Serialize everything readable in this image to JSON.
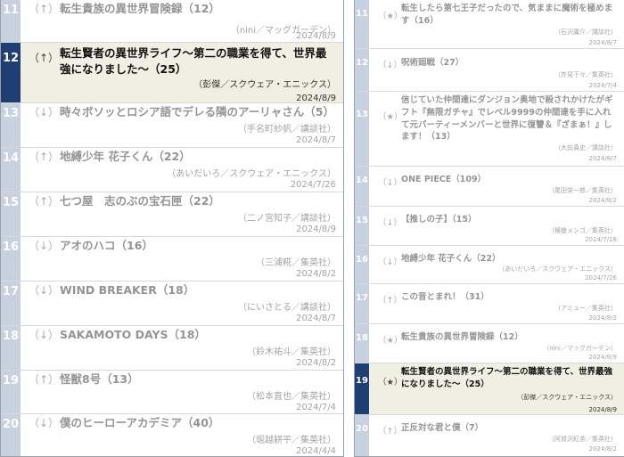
{
  "left_panel": {
    "rows": [
      {
        "rank": "11",
        "arrow": "（↑）",
        "title": "転生貴族の異世界冒険録（12）",
        "author": "（nini／マッグガーデン）",
        "date": "2024/8/9"
      },
      {
        "rank": "12",
        "arrow": "（↑）",
        "title": "転生賢者の異世界ライフ〜第二の職業を得て、世界最強になりました〜（25）",
        "author": "（彭傑／スクウェア・エニックス）",
        "date": "2024/8/9"
      },
      {
        "rank": "13",
        "arrow": "（↓）",
        "title": "時々ボソッとロシア語でデレる隣のアーリャさん（5）",
        "author": "（手名町紗帆／講談社）",
        "date": "2024/8/7"
      },
      {
        "rank": "14",
        "arrow": "（↑）",
        "title": "地縛少年 花子くん（22）",
        "author": "（あいだいろ／スクウェア・エニックス）",
        "date": "2024/7/26"
      },
      {
        "rank": "15",
        "arrow": "（↑）",
        "title": "七つ屋　志のぶの宝石匣（22）",
        "author": "（二ノ宮知子／講談社）",
        "date": "2024/8/9"
      },
      {
        "rank": "16",
        "arrow": "（↓）",
        "title": "アオのハコ（16）",
        "author": "（三浦糀／集英社）",
        "date": "2024/8/2"
      },
      {
        "rank": "17",
        "arrow": "（↓）",
        "title": "WIND BREAKER（18）",
        "author": "（にいさとる／講談社）",
        "date": "2024/8/7"
      },
      {
        "rank": "18",
        "arrow": "（↓）",
        "title": "SAKAMOTO DAYS（18）",
        "author": "（鈴木祐斗／集英社）",
        "date": "2024/8/2"
      },
      {
        "rank": "19",
        "arrow": "（↑）",
        "title": "怪獣8号（13）",
        "author": "（松本直也／集英社）",
        "date": "2024/7/4"
      },
      {
        "rank": "20",
        "arrow": "（↓）",
        "title": "僕のヒーローアカデミア（40）",
        "author": "（堀越耕平／集英社）",
        "date": "2024/4/4"
      }
    ]
  },
  "right_panel": {
    "rows": [
      {
        "rank": "11",
        "arrow": "（★）",
        "title": "転生したら第七王子だったので、気ままに魔術を極めます（16）",
        "author": "（石沢庸介／講談社）",
        "date": "2024/8/7"
      },
      {
        "rank": "12",
        "arrow": "（↓）",
        "title": "呪術廻戦（27）",
        "author": "（芥見下々／集英社）",
        "date": "2024/7/4"
      },
      {
        "rank": "13",
        "arrow": "（★）",
        "title": "信じていた仲間達にダンジョン奥地で殺されかけたがギフト『無限ガチャ』でレベル9999の仲間達を手に入れて元パーティーメンバーと世界に復讐＆『ざまぁ！』します！（13）",
        "author": "（大前貴史／講談社）",
        "date": "2024/8/7"
      },
      {
        "rank": "14",
        "arrow": "（↓）",
        "title": "ONE PIECE（109）",
        "author": "（尾田栄一郎／集英社）",
        "date": "2024/8/2"
      },
      {
        "rank": "15",
        "arrow": "（↓）",
        "title": "【推しの子】（15）",
        "author": "（横槍メンゴ／集英社）",
        "date": "2024/7/18"
      },
      {
        "rank": "16",
        "arrow": "（↓）",
        "title": "地縛少年 花子くん（22）",
        "author": "（あいだいろ／スクウェア・エニックス）",
        "date": "2024/7/26"
      },
      {
        "rank": "17",
        "arrow": "（↑）",
        "title": "この音とまれ！（31）",
        "author": "（アミュー／集英社）",
        "date": "2024/8/2"
      },
      {
        "rank": "18",
        "arrow": "（★）",
        "title": "転生貴族の異世界冒険録（12）",
        "author": "（nini／マッグガーデン）",
        "date": "2024/8/9"
      },
      {
        "rank": "19",
        "arrow": "（★）",
        "title": "転生賢者の異世界ライフ〜第二の職業を得て、世界最強になりました〜（25）",
        "author": "（彭傑／スクウェア・エニックス）",
        "date": "2024/8/9"
      },
      {
        "rank": "20",
        "arrow": "（↑）",
        "title": "正反対な君と僕（7）",
        "author": "（阿賀沢紅茶／集英社）",
        "date": "2024/8/2"
      }
    ]
  }
}
